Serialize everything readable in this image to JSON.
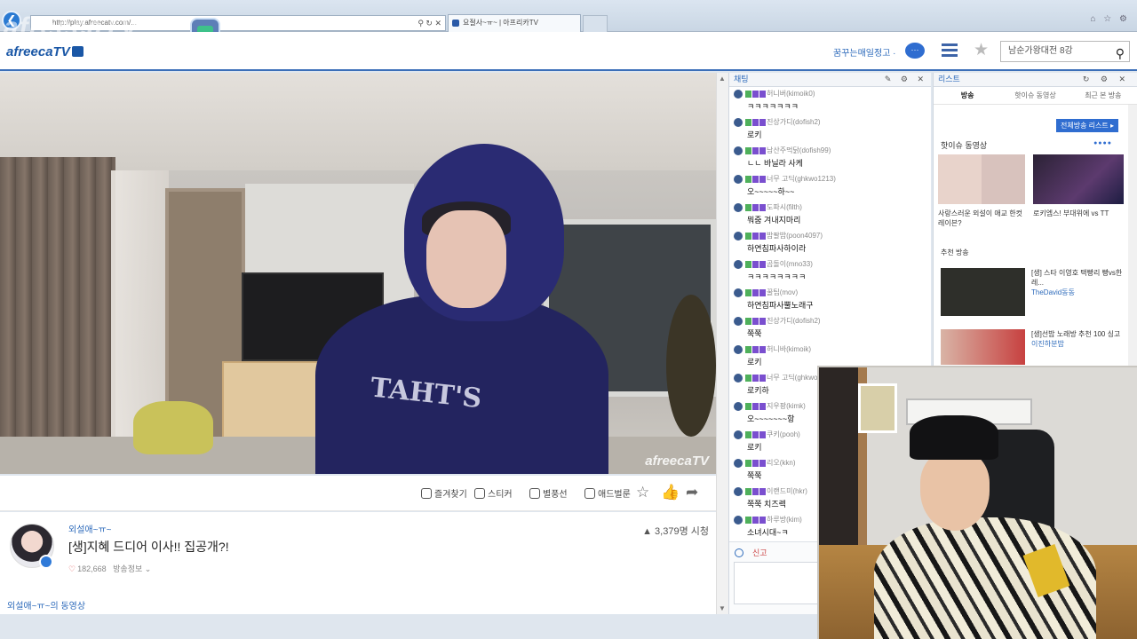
{
  "browser": {
    "url": "http://play.afreecatv.com/...",
    "tab_title": "요절사~ㅠ~ | 아프리카TV",
    "watermark": "afreecaTV"
  },
  "header": {
    "logo": "afreecaTV",
    "user_menu": "꿈꾸는매일정고 ·",
    "chat_icon": "···",
    "search_value": "남순가왕대전 8강"
  },
  "video": {
    "watermark": "afreecaTV",
    "print_text": "TAHT'S"
  },
  "toolbar": {
    "bookmark": "즐겨찾기",
    "sticker": "스티커",
    "balloon": "별풍선",
    "adballoon": "애드벌룬",
    "up_icon": "추천",
    "thumbs_icon": "좋아요",
    "share_icon": "공유"
  },
  "broadcast": {
    "streamer_name": "외설애~ㅠ~",
    "title": "[생]지혜 드디어 이사!! 집공개?!",
    "likes": "182,668",
    "meta_extra": "방송정보 ⌄",
    "viewers": "3,379명 시청",
    "vod_label": "외설애~ㅠ~의 동영상"
  },
  "chat": {
    "header": "채팅",
    "messages": [
      {
        "nick": "허니버(kimoik0)",
        "text": "ㅋㅋㅋㅋㅋㅋㅋ"
      },
      {
        "nick": "진상가디(dofish2)",
        "text": "로키"
      },
      {
        "nick": "남산주먹닭(dofish99)",
        "text": "ㄴㄴ 바닐라 사케"
      },
      {
        "nick": "너무 고딕(ghkwo1213)",
        "text": "오~~~~~하~~"
      },
      {
        "nick": "도파시(filth)",
        "text": "뭐줌 겨내지마리"
      },
      {
        "nick": "밥팔밥(poon4097)",
        "text": "하연침파사하이라"
      },
      {
        "nick": "곰돌이(mno33)",
        "text": "ㅋㅋㅋㅋㅋㅋㅋㅋ"
      },
      {
        "nick": "꿀팁(mov)",
        "text": "하연침파사뿔노래구"
      },
      {
        "nick": "진상가디(dofish2)",
        "text": "쭉쭉"
      },
      {
        "nick": "허니바(kimoik)",
        "text": "로키"
      },
      {
        "nick": "너무 고딕(ghkwo)",
        "text": "로키하"
      },
      {
        "nick": "지우팡(kimk)",
        "text": "오~~~~~~~항"
      },
      {
        "nick": "쿠키(pooh)",
        "text": "로키"
      },
      {
        "nick": "리오(kkn)",
        "text": "쭉쭉"
      },
      {
        "nick": "이랜드미(hkr)",
        "text": "쭉쭉 치즈렉"
      },
      {
        "nick": "하루방(kim)",
        "text": "소녀시대~ㅋ"
      }
    ],
    "input_label": "신고"
  },
  "list_panel": {
    "header": "리스트",
    "tabs": [
      "방송",
      "핫이슈 동영상",
      "최근 본 방송"
    ],
    "all_list_button": "전체방송 리스트 ▸",
    "hot_title": "핫이슈 동영상",
    "hot_dots": "●●●●",
    "hot_items": [
      {
        "caption": "사랑스러운 외설이 애교 한컷 레이븐?"
      },
      {
        "caption": "로키엠스! 부대위에 vs TT"
      }
    ],
    "rec_title": "추천 방송",
    "rec_items": [
      {
        "title": "[생] 스타 이영호 택빵리 빵vs한레...",
        "sub": "TheDavid동동"
      },
      {
        "title": "[생]선밥 노래방 추천 100 싱고",
        "sub": "이진하분밥"
      }
    ]
  }
}
